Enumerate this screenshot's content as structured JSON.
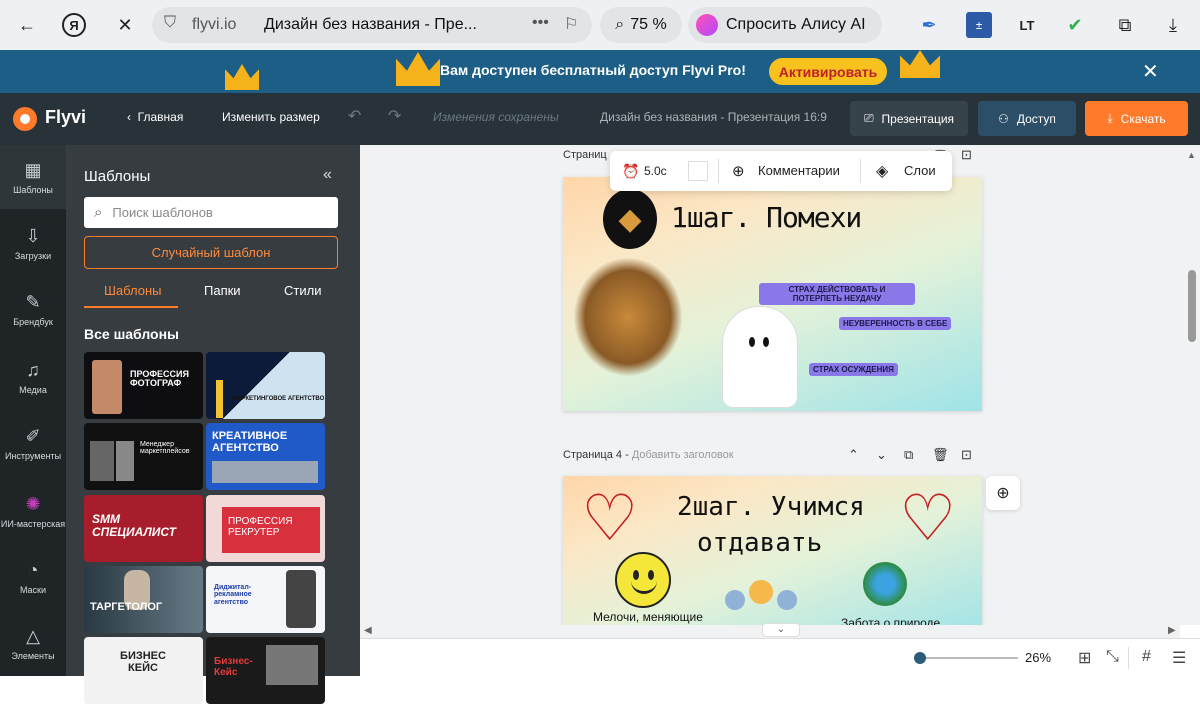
{
  "browser": {
    "host": "flyvi.io",
    "tab_title": "Дизайн без названия - Пре...",
    "zoom": "75 %",
    "alice_label": "Спросить Алису AI",
    "badge_lt": "LT"
  },
  "promo": {
    "text": "Вам доступен бесплатный доступ Flyvi Pro!",
    "activate": "Активировать"
  },
  "topbar": {
    "logo": "Flyvi",
    "home": "Главная",
    "resize": "Изменить размер",
    "saved": "Изменения сохранены",
    "doc_title": "Дизайн без названия - Презентация 16:9",
    "present": "Презентация",
    "access": "Доступ",
    "download": "Скачать"
  },
  "leftnav": [
    {
      "label": "Шаблоны",
      "icon": "templates-icon",
      "glyph": "▦"
    },
    {
      "label": "Загрузки",
      "icon": "upload-icon",
      "glyph": "⇩"
    },
    {
      "label": "Брендбук",
      "icon": "brandbook-icon",
      "glyph": "✎"
    },
    {
      "label": "Медиа",
      "icon": "media-icon",
      "glyph": "♫"
    },
    {
      "label": "Инструменты",
      "icon": "tools-icon",
      "glyph": "✐"
    },
    {
      "label": "ИИ-мастерская",
      "icon": "ai-workshop-icon",
      "glyph": "✺"
    },
    {
      "label": "Маски",
      "icon": "masks-icon",
      "glyph": "◔"
    },
    {
      "label": "Элементы",
      "icon": "elements-icon",
      "glyph": "△"
    }
  ],
  "panel": {
    "title": "Шаблоны",
    "search_placeholder": "Поиск шаблонов",
    "random": "Случайный шаблон",
    "tabs": [
      "Шаблоны",
      "Папки",
      "Стили"
    ],
    "all_templates": "Все шаблоны",
    "templates": [
      {
        "title": "ПРОФЕССИЯ ФОТОГРАФ"
      },
      {
        "title": "МАРКЕТИНГОВОЕ АГЕНТСТВО"
      },
      {
        "title": "Менеджер маркетплейсов"
      },
      {
        "title": "КРЕАТИВНОЕ АГЕНТСТВО"
      },
      {
        "title": "SMM СПЕЦИАЛИСТ"
      },
      {
        "title": "ПРОФЕССИЯ РЕКРУТЕР"
      },
      {
        "title": "ТАРГЕТОЛОГ"
      },
      {
        "title": "Диджитал-рекламное агентство"
      },
      {
        "title": "БИЗНЕС КЕЙС"
      },
      {
        "title": "Бизнес-Кейс"
      }
    ]
  },
  "floatbar": {
    "timer": "5.0с",
    "comments": "Комментарии",
    "layers": "Слои"
  },
  "slide3": {
    "page_label": "Страниц",
    "title": "1шаг. Помехи",
    "pills": [
      "СТРАХ ДЕЙСТВОВАТЬ И ПОТЕРПЕТЬ НЕУДАЧУ",
      "НЕУВЕРЕННОСТЬ В СЕБЕ",
      "СТРАХ ОСУЖДЕНИЯ"
    ]
  },
  "slide4": {
    "page_label": "Страница 4 -",
    "add_title": "Добавить заголовок",
    "title_line1": "2шаг. Учимся",
    "title_line2": "отдавать",
    "caption_left": "Мелочи, меняющие",
    "caption_right": "Забота о природе"
  },
  "bottombar": {
    "zoom": "26%",
    "zoom_level": 0.02
  }
}
